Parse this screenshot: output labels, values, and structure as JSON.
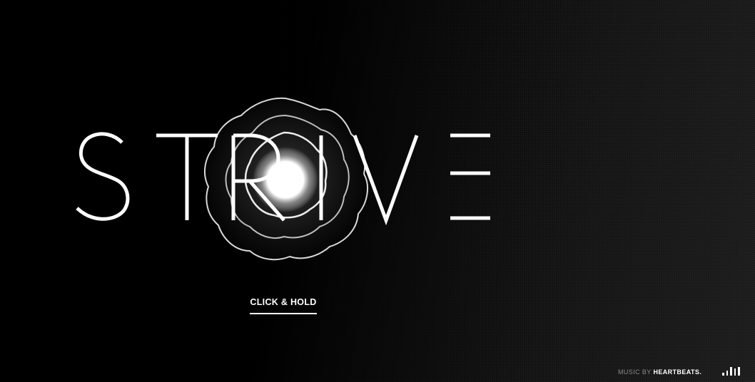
{
  "hero": {
    "letters": [
      "S",
      "T",
      "R",
      "I",
      "V",
      "E"
    ],
    "title": "STRIVE"
  },
  "cta": {
    "label": "CLICK & HOLD"
  },
  "footer": {
    "credit_prefix": "MUSIC BY",
    "credit_brand": "HEARTBEATS."
  },
  "audio_toggle": {
    "icon": "sound-bars-icon",
    "bar_levels": [
      0.35,
      0.55,
      1.0,
      0.8,
      1.0
    ]
  },
  "colors": {
    "text": "#ffffff",
    "background": "#000000",
    "muted": "#8a8a8a"
  }
}
